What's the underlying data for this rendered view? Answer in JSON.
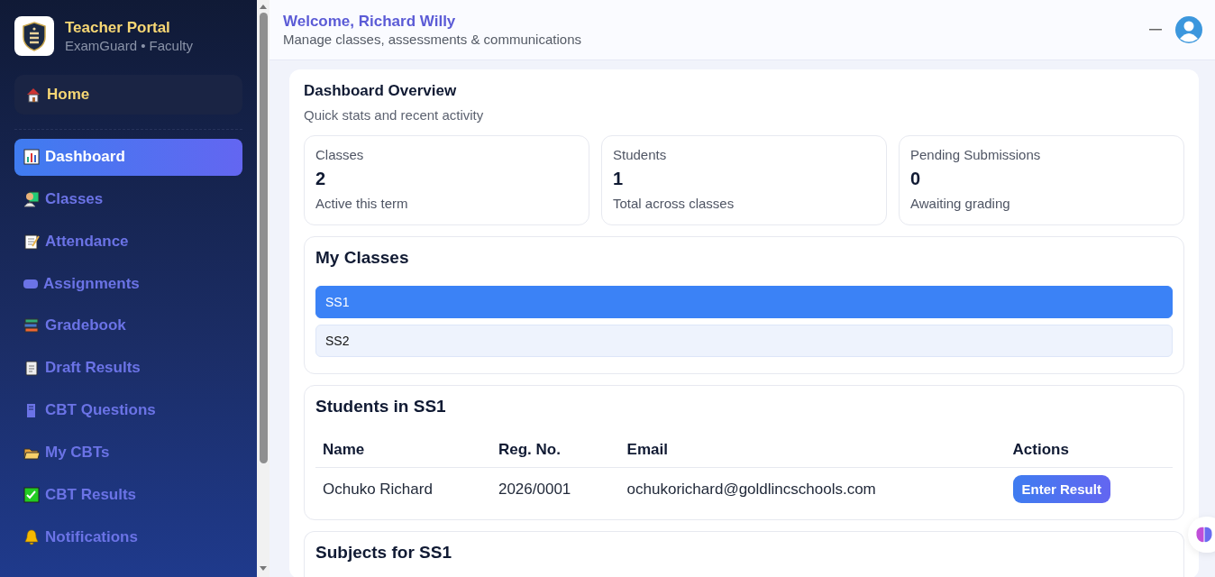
{
  "brand": {
    "title": "Teacher Portal",
    "subtitle": "ExamGuard • Faculty"
  },
  "home": {
    "label": "Home"
  },
  "nav": [
    {
      "label": "Dashboard",
      "selected": true
    },
    {
      "label": "Classes",
      "selected": false
    },
    {
      "label": "Attendance",
      "selected": false
    },
    {
      "label": "Assignments",
      "selected": false
    },
    {
      "label": "Gradebook",
      "selected": false
    },
    {
      "label": "Draft Results",
      "selected": false
    },
    {
      "label": "CBT Questions",
      "selected": false
    },
    {
      "label": "My CBTs",
      "selected": false
    },
    {
      "label": "CBT Results",
      "selected": false
    },
    {
      "label": "Notifications",
      "selected": false
    }
  ],
  "header": {
    "title": "Welcome, Richard Willy",
    "subtitle": "Manage classes, assessments & communications"
  },
  "overview": {
    "title": "Dashboard Overview",
    "subtitle": "Quick stats and recent activity",
    "stats": [
      {
        "label": "Classes",
        "value": "2",
        "note": "Active this term"
      },
      {
        "label": "Students",
        "value": "1",
        "note": "Total across classes"
      },
      {
        "label": "Pending Submissions",
        "value": "0",
        "note": "Awaiting grading"
      }
    ]
  },
  "classes": {
    "title": "My Classes",
    "items": [
      {
        "label": "SS1",
        "selected": true
      },
      {
        "label": "SS2",
        "selected": false
      }
    ]
  },
  "students": {
    "title": "Students in SS1",
    "columns": [
      "Name",
      "Reg. No.",
      "Email",
      "Actions"
    ],
    "rows": [
      {
        "name": "Ochuko Richard",
        "reg_no": "2026/0001",
        "email": "ochukorichard@goldlincschools.com",
        "action": "Enter Result"
      }
    ]
  },
  "subjects": {
    "title": "Subjects for SS1"
  }
}
